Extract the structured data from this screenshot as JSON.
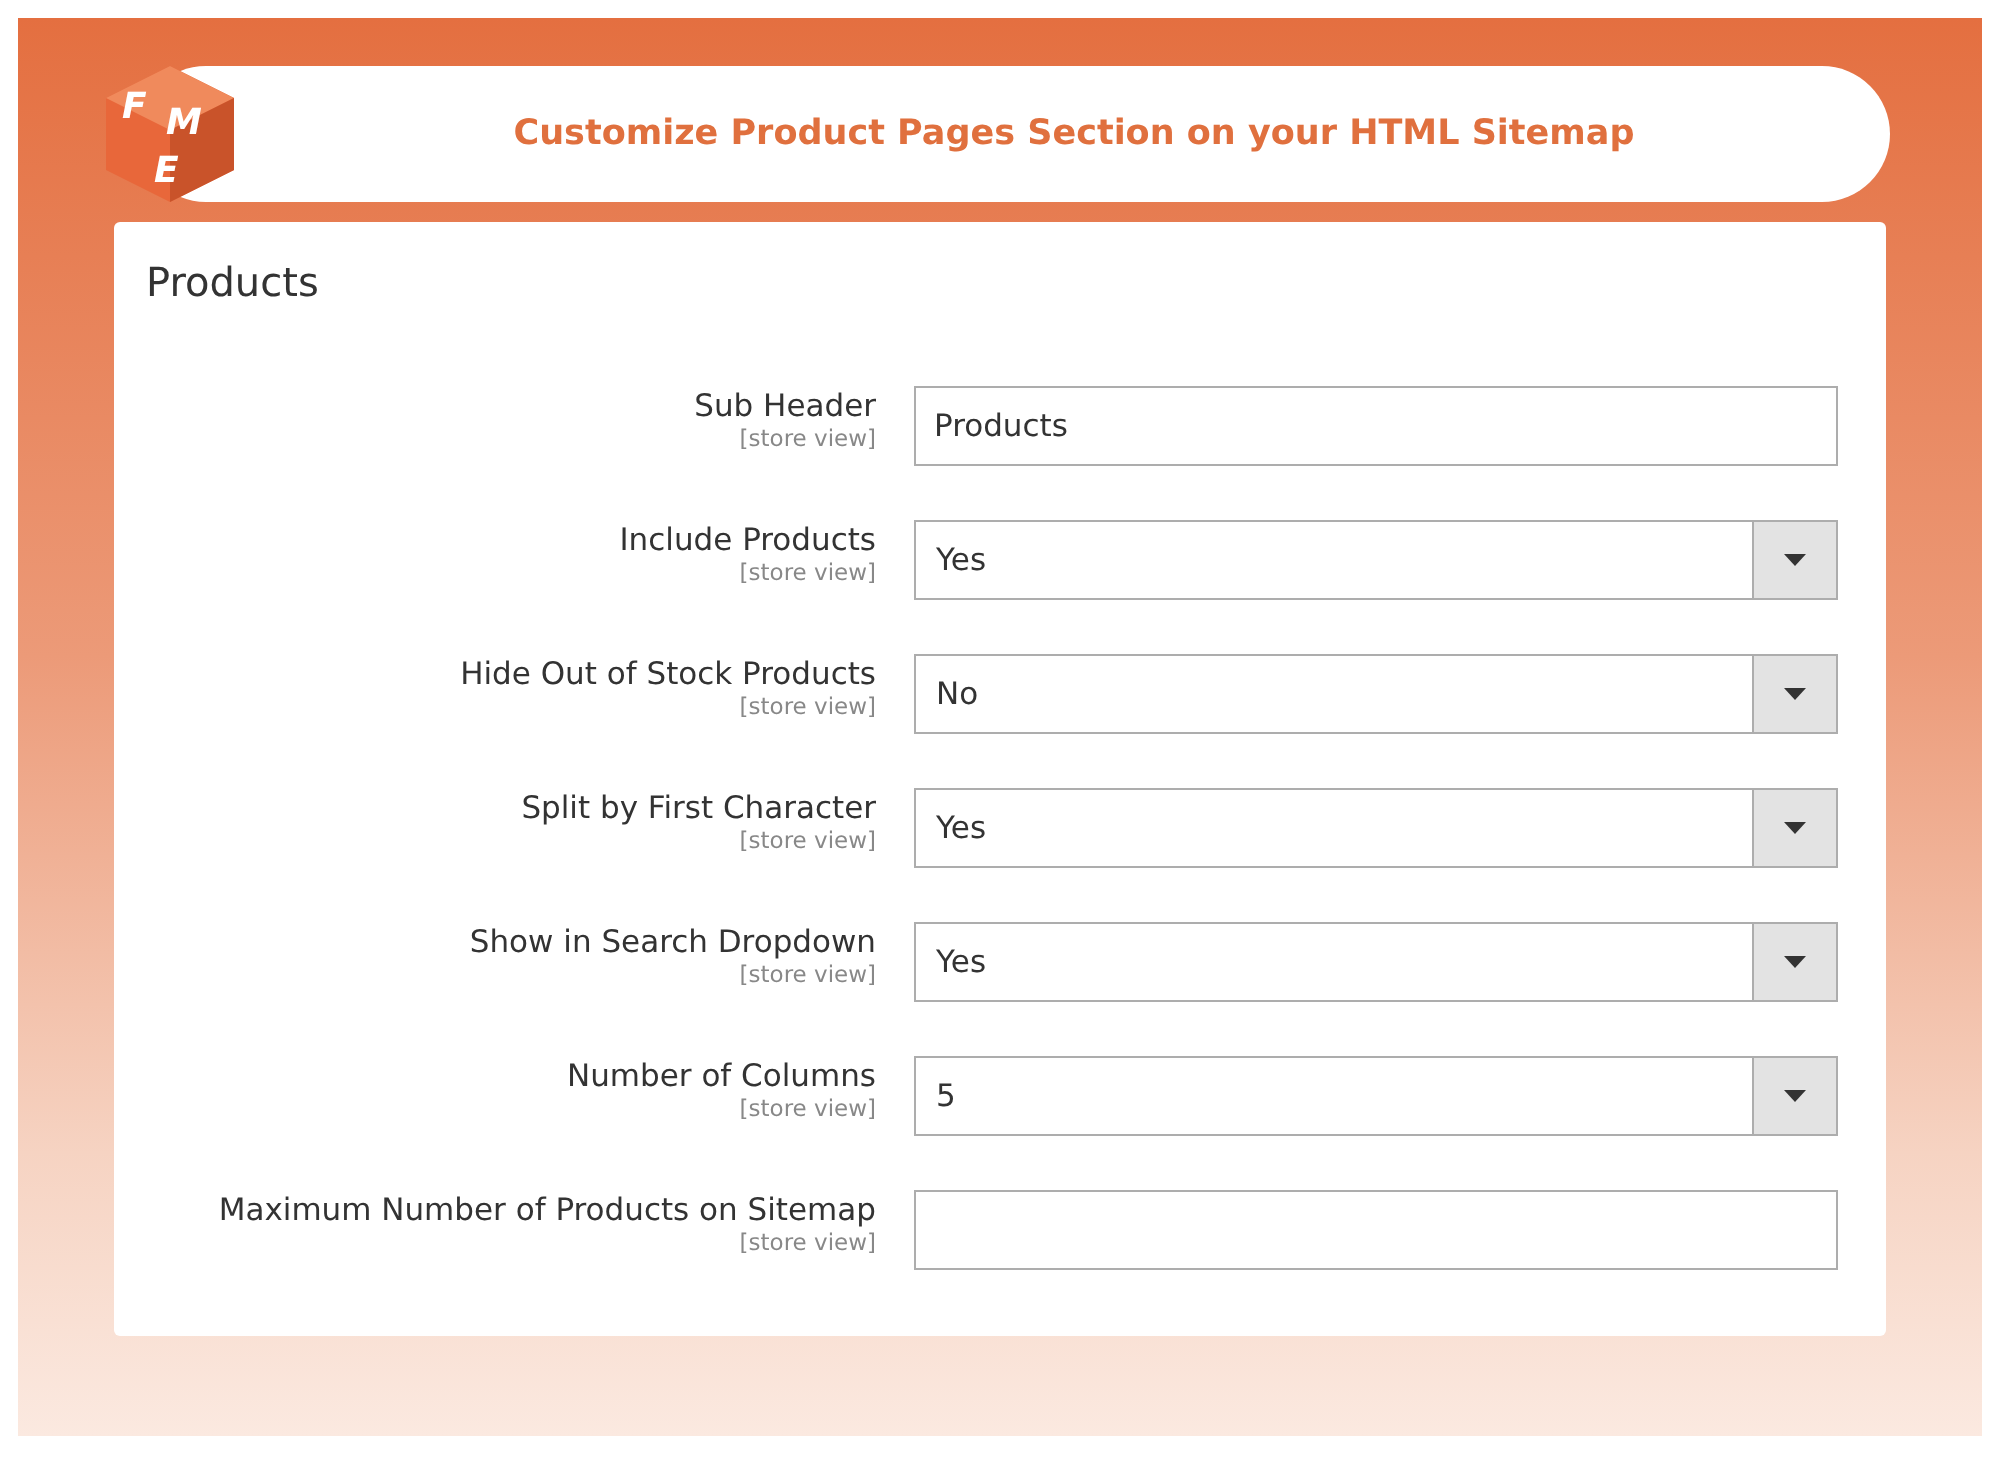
{
  "logo": {
    "letters": [
      "F",
      "M",
      "E"
    ]
  },
  "banner": {
    "title": "Customize Product Pages Section on your HTML Sitemap"
  },
  "section": {
    "title": "Products"
  },
  "fields": [
    {
      "kind": "text",
      "label": "Sub Header",
      "scope": "[store view]",
      "value": "Products"
    },
    {
      "kind": "select",
      "label": "Include Products",
      "scope": "[store view]",
      "value": "Yes"
    },
    {
      "kind": "select",
      "label": "Hide Out of Stock Products",
      "scope": "[store view]",
      "value": "No"
    },
    {
      "kind": "select",
      "label": "Split by First Character",
      "scope": "[store view]",
      "value": "Yes"
    },
    {
      "kind": "select",
      "label": "Show in Search Dropdown",
      "scope": "[store view]",
      "value": "Yes"
    },
    {
      "kind": "select",
      "label": "Number of Columns",
      "scope": "[store view]",
      "value": "5"
    },
    {
      "kind": "text",
      "label": "Maximum Number of Products on Sitemap",
      "scope": "[store view]"
    }
  ]
}
